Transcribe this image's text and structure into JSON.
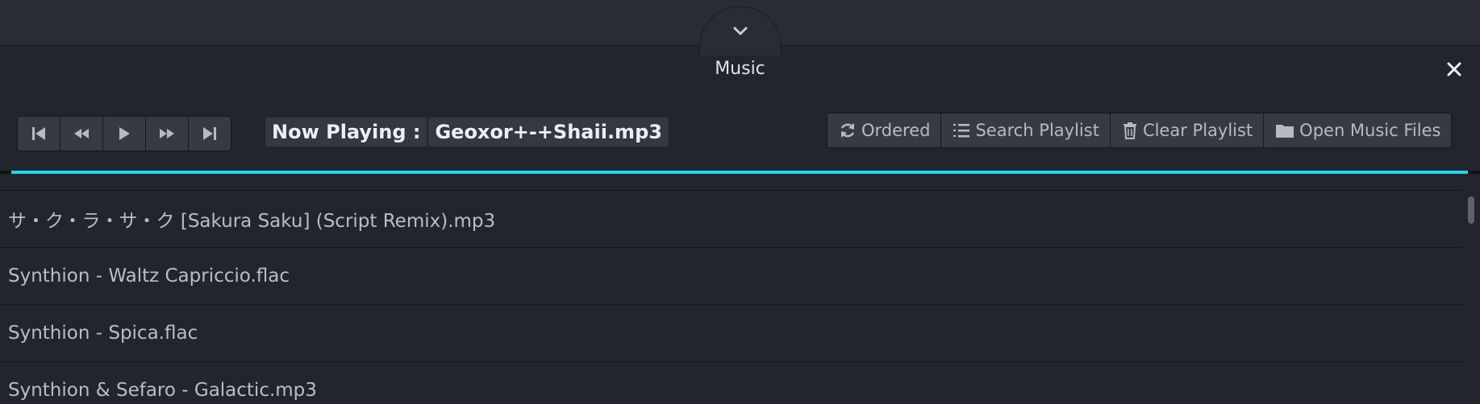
{
  "window": {
    "title": "Music",
    "collapse_icon": "chevron-down-icon",
    "close_icon": "close-icon"
  },
  "transport": {
    "buttons": [
      {
        "name": "skip-to-start-button",
        "icon": "skip-start-icon"
      },
      {
        "name": "rewind-button",
        "icon": "rewind-icon"
      },
      {
        "name": "play-button",
        "icon": "play-icon"
      },
      {
        "name": "fast-forward-button",
        "icon": "fast-forward-icon"
      },
      {
        "name": "skip-to-end-button",
        "icon": "skip-end-icon"
      }
    ]
  },
  "now_playing": {
    "label": "Now Playing :",
    "track": "Geoxor+-+Shaii.mp3"
  },
  "actions": {
    "ordered": {
      "label": "Ordered",
      "icon": "refresh-icon"
    },
    "search": {
      "label": "Search Playlist",
      "icon": "list-ordered-icon"
    },
    "clear": {
      "label": "Clear Playlist",
      "icon": "trash-icon"
    },
    "open": {
      "label": "Open Music Files",
      "icon": "folder-icon"
    }
  },
  "progress": {
    "fraction": 0.992,
    "color": "#22d4e6"
  },
  "playlist": [
    "サ・ク・ラ・サ・ク [Sakura Saku] (Script Remix).mp3",
    "Synthion - Waltz Capriccio.flac",
    "Synthion - Spica.flac",
    "Synthion & Sefaro - Galactic.mp3"
  ],
  "colors": {
    "background": "#22252d",
    "button": "#363a44",
    "accent": "#22d4e6"
  }
}
